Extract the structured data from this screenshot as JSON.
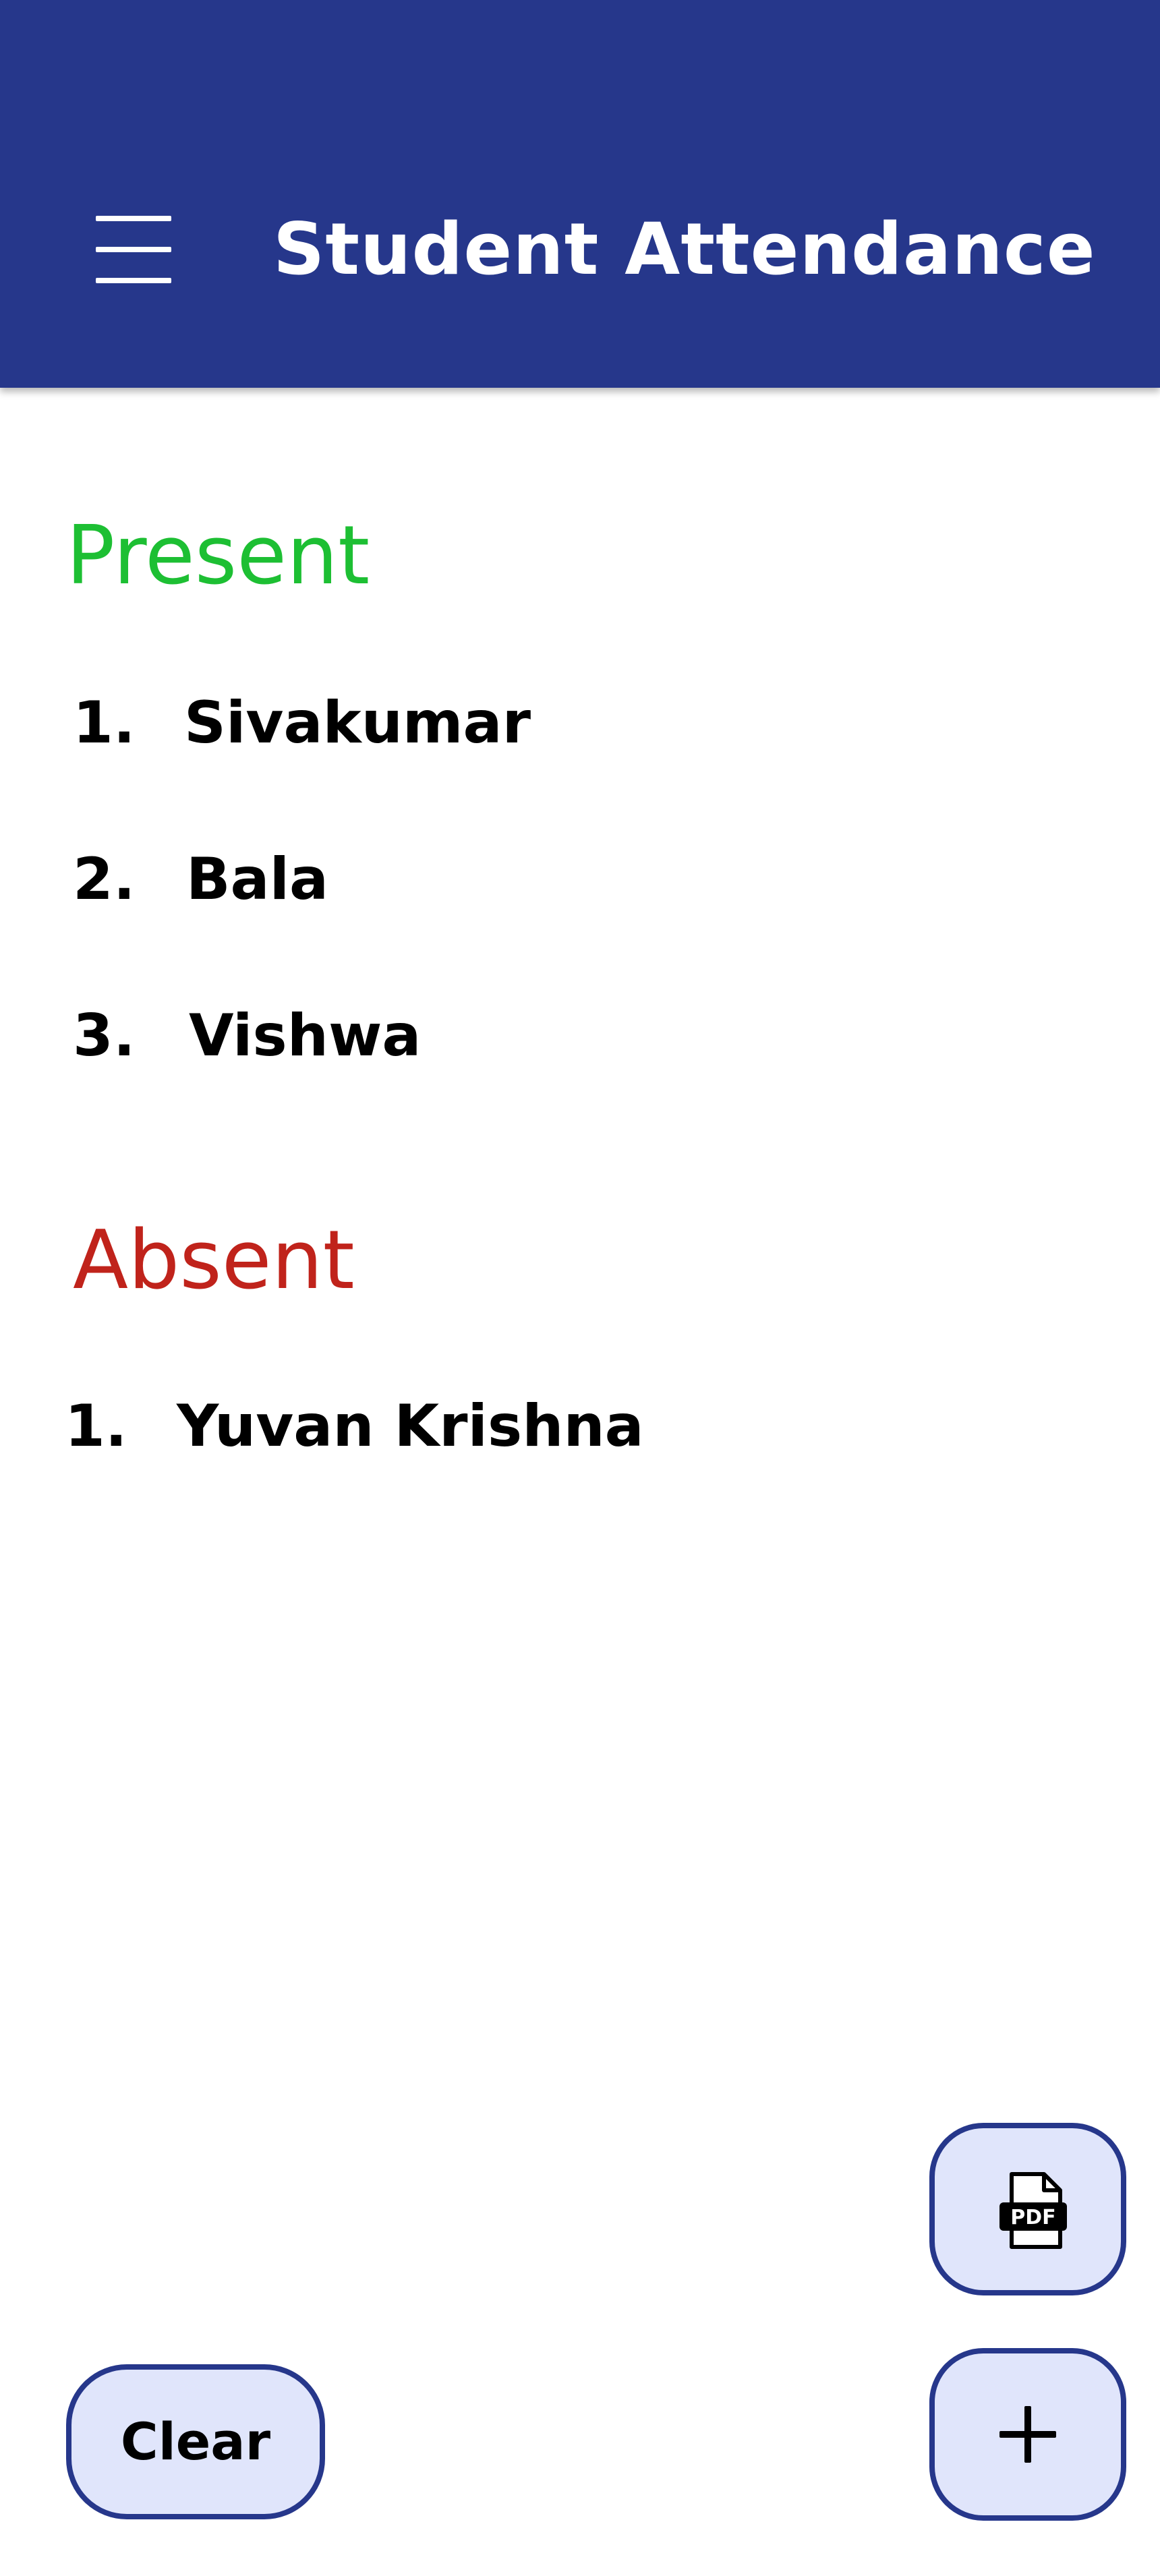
{
  "app_bar": {
    "title": "Student Attendance",
    "menu_icon": "hamburger-menu-icon",
    "background_color": "#26378b"
  },
  "present": {
    "heading": "Present",
    "color": "#1dbf33",
    "students": [
      {
        "number": "1.",
        "name": "Sivakumar"
      },
      {
        "number": "2.",
        "name": "Bala"
      },
      {
        "number": "3.",
        "name": "Vishwa"
      }
    ]
  },
  "absent": {
    "heading": "Absent",
    "color": "#c0231b",
    "students": [
      {
        "number": "1.",
        "name": "Yuvan Krishna"
      }
    ]
  },
  "actions": {
    "pdf": {
      "icon": "pdf-file-icon",
      "icon_text": "PDF"
    },
    "add": {
      "icon": "plus-icon"
    },
    "clear_label": "Clear",
    "button_fill": "#e0e5fb",
    "button_border": "#26378b"
  }
}
